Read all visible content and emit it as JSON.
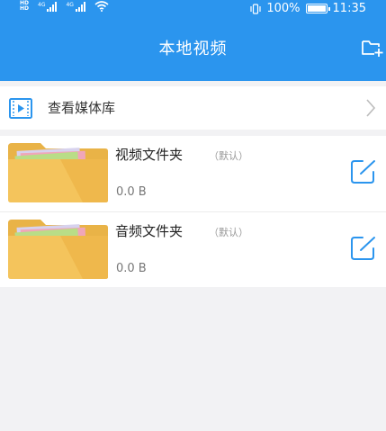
{
  "status_bar": {
    "sim_tag": "HD",
    "signal_1": "4G",
    "signal_2": "4G",
    "battery_percent": "100%",
    "time": "11:35"
  },
  "header": {
    "title": "本地视频"
  },
  "library": {
    "label": "查看媒体库"
  },
  "folders": [
    {
      "name": "视频文件夹",
      "default_tag": "（默认）",
      "size": "0.0 B"
    },
    {
      "name": "音频文件夹",
      "default_tag": "（默认）",
      "size": "0.0 B"
    }
  ],
  "colors": {
    "accent": "#2b95ee",
    "folder_yellow": "#f4c45c",
    "icon_blue": "#2b95ee"
  },
  "icons": [
    "signal-icon",
    "wifi-icon",
    "vibrate-icon",
    "battery-icon",
    "add-folder-icon",
    "media-library-icon",
    "chevron-right-icon",
    "folder-icon",
    "edit-icon"
  ]
}
